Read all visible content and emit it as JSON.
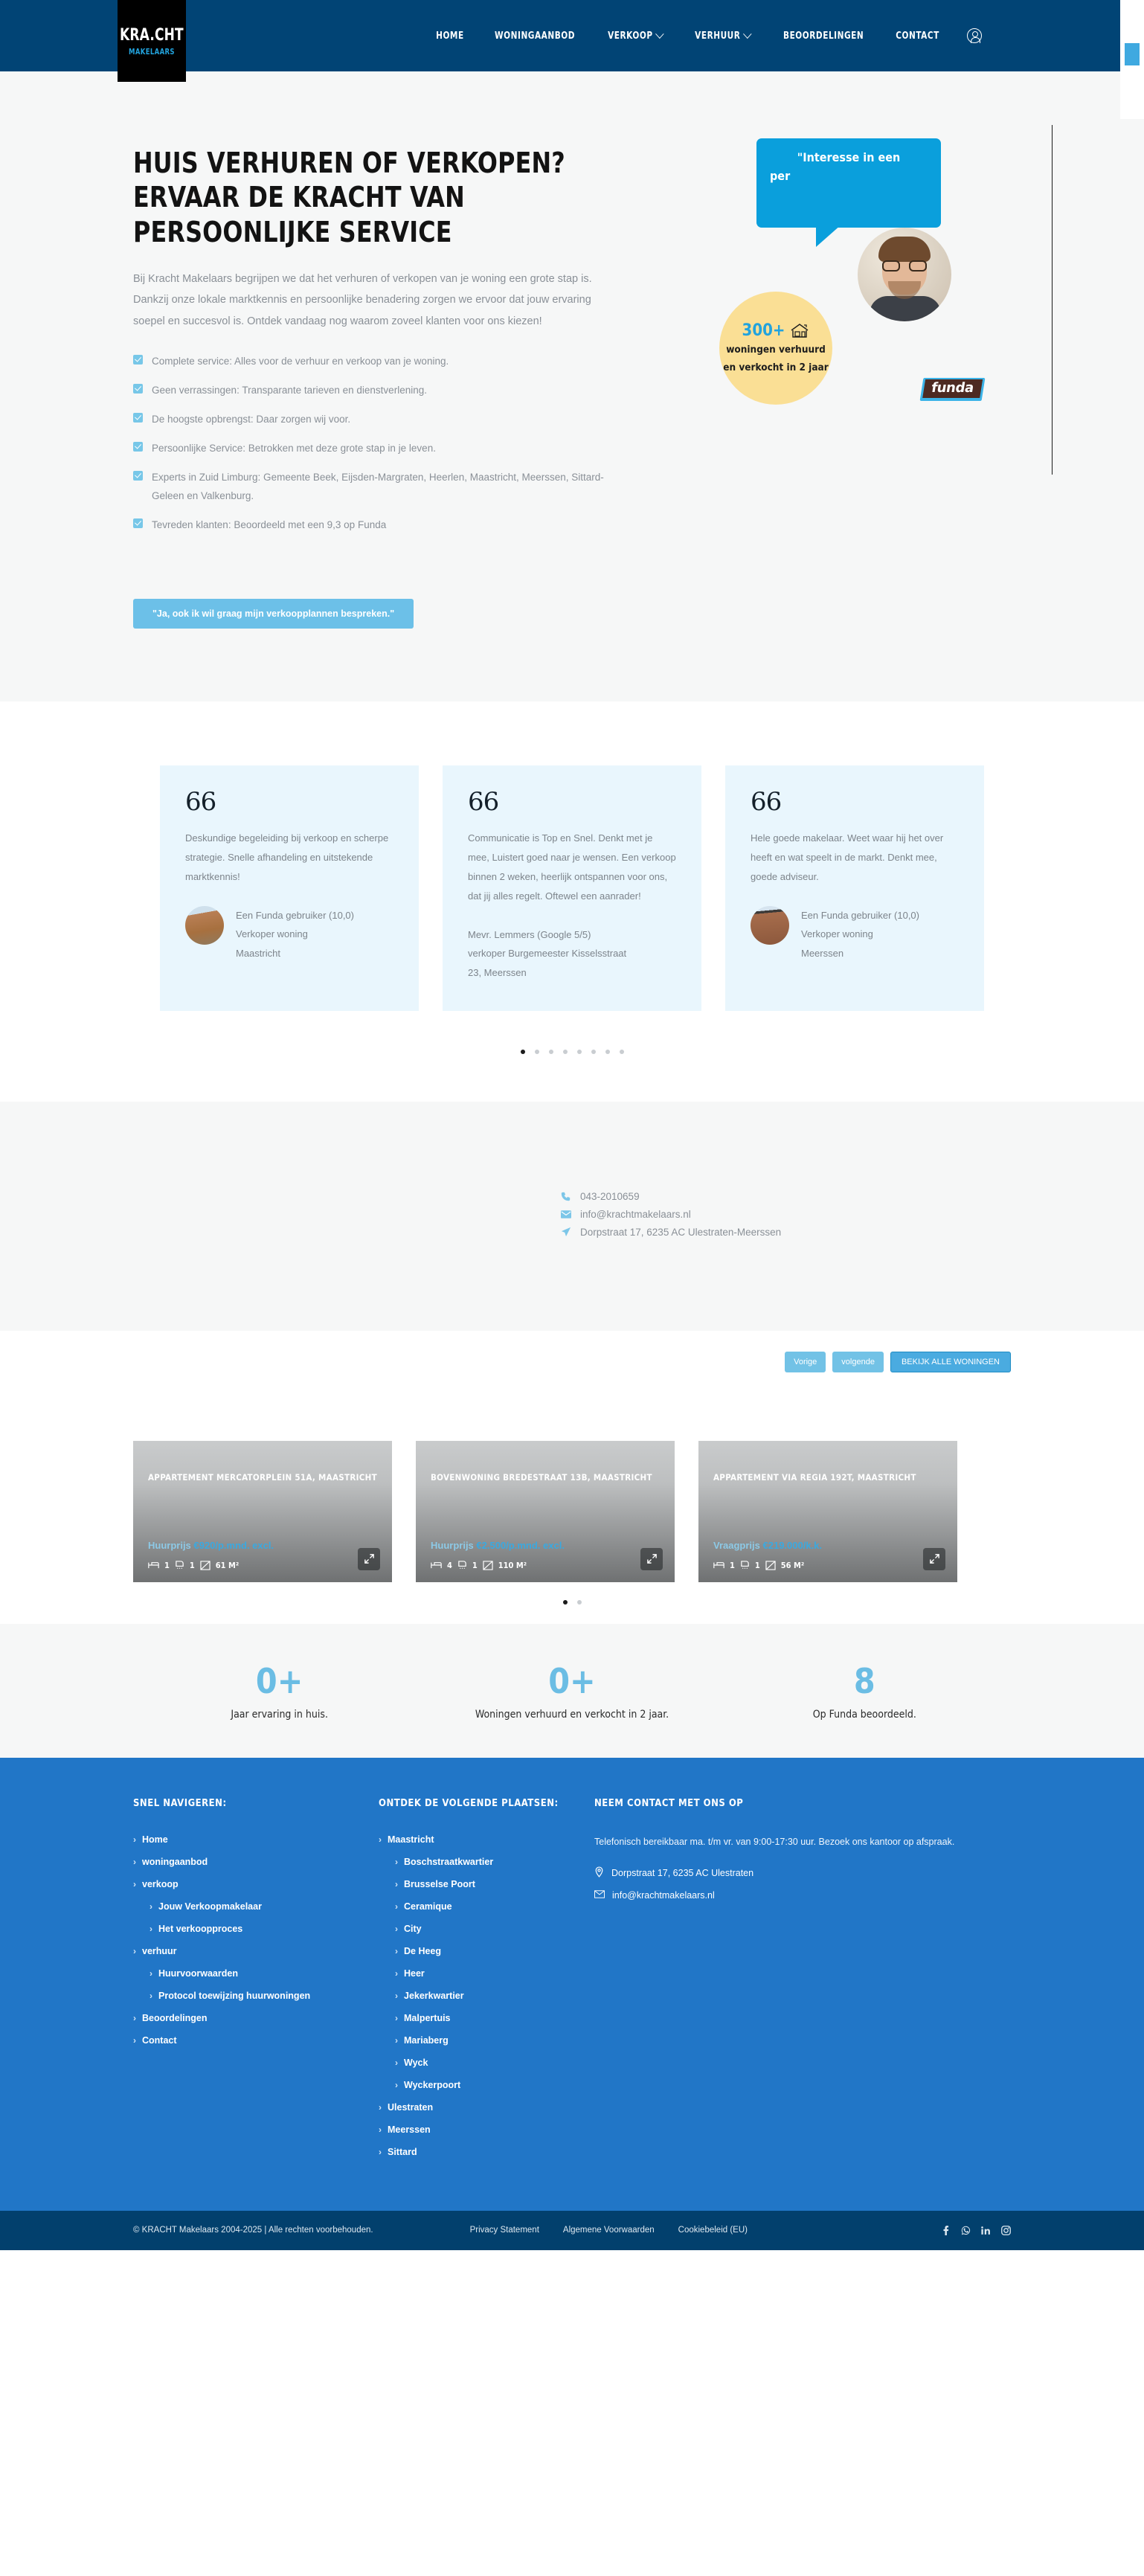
{
  "brand": {
    "logo_main": "KRA.CHT",
    "logo_sub": "MAKELAARS"
  },
  "nav": {
    "items": [
      {
        "label": "HOME",
        "has_chevron": false
      },
      {
        "label": "WONINGAANBOD",
        "has_chevron": false
      },
      {
        "label": "VERKOOP",
        "has_chevron": true
      },
      {
        "label": "VERHUUR",
        "has_chevron": true
      },
      {
        "label": "BEOORDELINGEN",
        "has_chevron": false
      },
      {
        "label": "CONTACT",
        "has_chevron": false
      }
    ],
    "account_icon": "user-circle-icon"
  },
  "hero": {
    "title": "HUIS VERHUREN OF VERKOPEN? ERVAAR DE KRACHT VAN PERSOONLIJKE SERVICE",
    "paragraph": "Bij Kracht Makelaars begrijpen we dat het verhuren of verkopen van je woning een grote stap is. Dankzij onze lokale marktkennis en persoonlijke benadering zorgen we ervoor dat jouw ervaring soepel en succesvol is. Ontdek vandaag nog waarom zoveel klanten voor ons kiezen!",
    "checklist": [
      "Complete service: Alles voor de verhuur en verkoop van je woning.",
      "Geen verrassingen: Transparante tarieven en dienstverlening.",
      "De hoogste opbrengst: Daar zorgen wij voor.",
      "Persoonlijke Service: Betrokken met deze grote stap in je leven.",
      "Experts in Zuid Limburg: Gemeente Beek, Eijsden-Margraten, Heerlen, Maastricht, Meerssen, Sittard-Geleen en Valkenburg.",
      "Tevreden klanten: Beoordeeld met een 9,3 op Funda"
    ],
    "cta_label": "\"Ja, ook ik wil graag mijn verkoopplannen bespreken.\"",
    "bubble_line1": "\"Interesse in een",
    "bubble_line2": "per",
    "badge_number": "300+",
    "badge_line1": "woningen verhuurd",
    "badge_line2": "en verkocht in 2 jaar",
    "funda_label": "funda"
  },
  "testimonials": {
    "quote_glyph": "66",
    "cards": [
      {
        "body": "Deskundige begeleiding bij verkoop en scherpe strategie. Snelle afhandeling en uitstekende marktkennis!",
        "author": "Een Funda gebruiker (10,0)",
        "role": "Verkoper woning",
        "place": "Maastricht",
        "has_avatar": true
      },
      {
        "body": "Communicatie is Top en Snel. Denkt met je mee, Luistert goed naar je wensen. Een verkoop binnen 2 weken, heerlijk ontspannen voor ons, dat jij alles regelt. Oftewel een aanrader!",
        "author": "Mevr. Lemmers (Google 5/5)",
        "role": "verkoper Burgemeester Kisselsstraat",
        "place": "23, Meerssen",
        "has_avatar": false
      },
      {
        "body": "Hele goede makelaar. Weet waar hij het over heeft en wat speelt in de markt. Denkt mee, goede adviseur.",
        "author": "Een Funda gebruiker (10,0)",
        "role": "Verkoper woning",
        "place": "Meerssen",
        "has_avatar": true
      }
    ],
    "dot_count": 8,
    "active_dot": 0
  },
  "contact_strip": {
    "phone": "043-2010659",
    "email": "info@krachtmakelaars.nl",
    "address": "Dorpstraat 17, 6235 AC Ulestraten-Meerssen"
  },
  "listings": {
    "prev_label": "Vorige",
    "next_label": "volgende",
    "all_label": "BEKIJK ALLE WONINGEN",
    "cards": [
      {
        "title": "APPARTEMENT MERCATORPLEIN 51A, MAASTRICHT",
        "price_label": "Huurprijs",
        "price_value": "€920/p.mnd. excl.",
        "beds": "1",
        "baths": "1",
        "area": "61 M²"
      },
      {
        "title": "BOVENWONING BREDESTRAAT 13B, MAASTRICHT",
        "price_label": "Huurprijs",
        "price_value": "€2.500/p.mnd. excl.",
        "beds": "4",
        "baths": "1",
        "area": "110 M²"
      },
      {
        "title": "APPARTEMENT VIA REGIA 192T, MAASTRICHT",
        "price_label": "Vraagprijs",
        "price_value": "€219.000/k.k.",
        "beds": "1",
        "baths": "1",
        "area": "56 M²"
      }
    ],
    "dot_count": 2,
    "active_dot": 0
  },
  "stats": [
    {
      "number": "0+",
      "label": "Jaar ervaring in huis."
    },
    {
      "number": "0+",
      "label": "Woningen verhuurd en verkocht in 2 jaar."
    },
    {
      "number": "8",
      "label": "Op Funda beoordeeld."
    }
  ],
  "footer": {
    "col1_head": "SNEL NAVIGEREN:",
    "col1_links": [
      {
        "label": "Home",
        "sub": false
      },
      {
        "label": "woningaanbod",
        "sub": false
      },
      {
        "label": "verkoop",
        "sub": false
      },
      {
        "label": "Jouw Verkoopmakelaar",
        "sub": true
      },
      {
        "label": "Het verkoopproces",
        "sub": true
      },
      {
        "label": "verhuur",
        "sub": false
      },
      {
        "label": "Huurvoorwaarden",
        "sub": true
      },
      {
        "label": "Protocol toewijzing huurwoningen",
        "sub": true
      },
      {
        "label": "Beoordelingen",
        "sub": false
      },
      {
        "label": "Contact",
        "sub": false
      }
    ],
    "col2_head": "ONTDEK DE VOLGENDE PLAATSEN:",
    "col2_links": [
      {
        "label": "Maastricht",
        "sub": false
      },
      {
        "label": "Boschstraatkwartier",
        "sub": true
      },
      {
        "label": "Brusselse Poort",
        "sub": true
      },
      {
        "label": "Ceramique",
        "sub": true
      },
      {
        "label": "City",
        "sub": true
      },
      {
        "label": "De Heeg",
        "sub": true
      },
      {
        "label": "Heer",
        "sub": true
      },
      {
        "label": "Jekerkwartier",
        "sub": true
      },
      {
        "label": "Malpertuis",
        "sub": true
      },
      {
        "label": "Mariaberg",
        "sub": true
      },
      {
        "label": "Wyck",
        "sub": true
      },
      {
        "label": "Wyckerpoort",
        "sub": true
      },
      {
        "label": "Ulestraten",
        "sub": false
      },
      {
        "label": "Meerssen",
        "sub": false
      },
      {
        "label": "Sittard",
        "sub": false
      }
    ],
    "col3_head": "NEEM CONTACT MET ONS OP",
    "col3_body": "Telefonisch bereikbaar ma. t/m vr. van 9:00-17:30 uur. Bezoek ons kantoor op afspraak.",
    "col3_address": "Dorpstraat 17, 6235 AC Ulestraten",
    "col3_email": "info@krachtmakelaars.nl"
  },
  "bottombar": {
    "copyright": "© KRACHT Makelaars 2004-2025 | Alle rechten voorbehouden.",
    "legal": [
      "Privacy Statement",
      "Algemene Voorwaarden",
      "Cookiebeleid (EU)"
    ],
    "socials": [
      "facebook-icon",
      "whatsapp-icon",
      "linkedin-icon",
      "instagram-icon"
    ]
  },
  "colors": {
    "navy": "#014475",
    "accent_blue": "#0a9fdc",
    "light_blue": "#6cc0e8",
    "badge_yellow": "#fadf95",
    "footer_blue": "#2176c7",
    "bottom_navy": "#02406d"
  }
}
